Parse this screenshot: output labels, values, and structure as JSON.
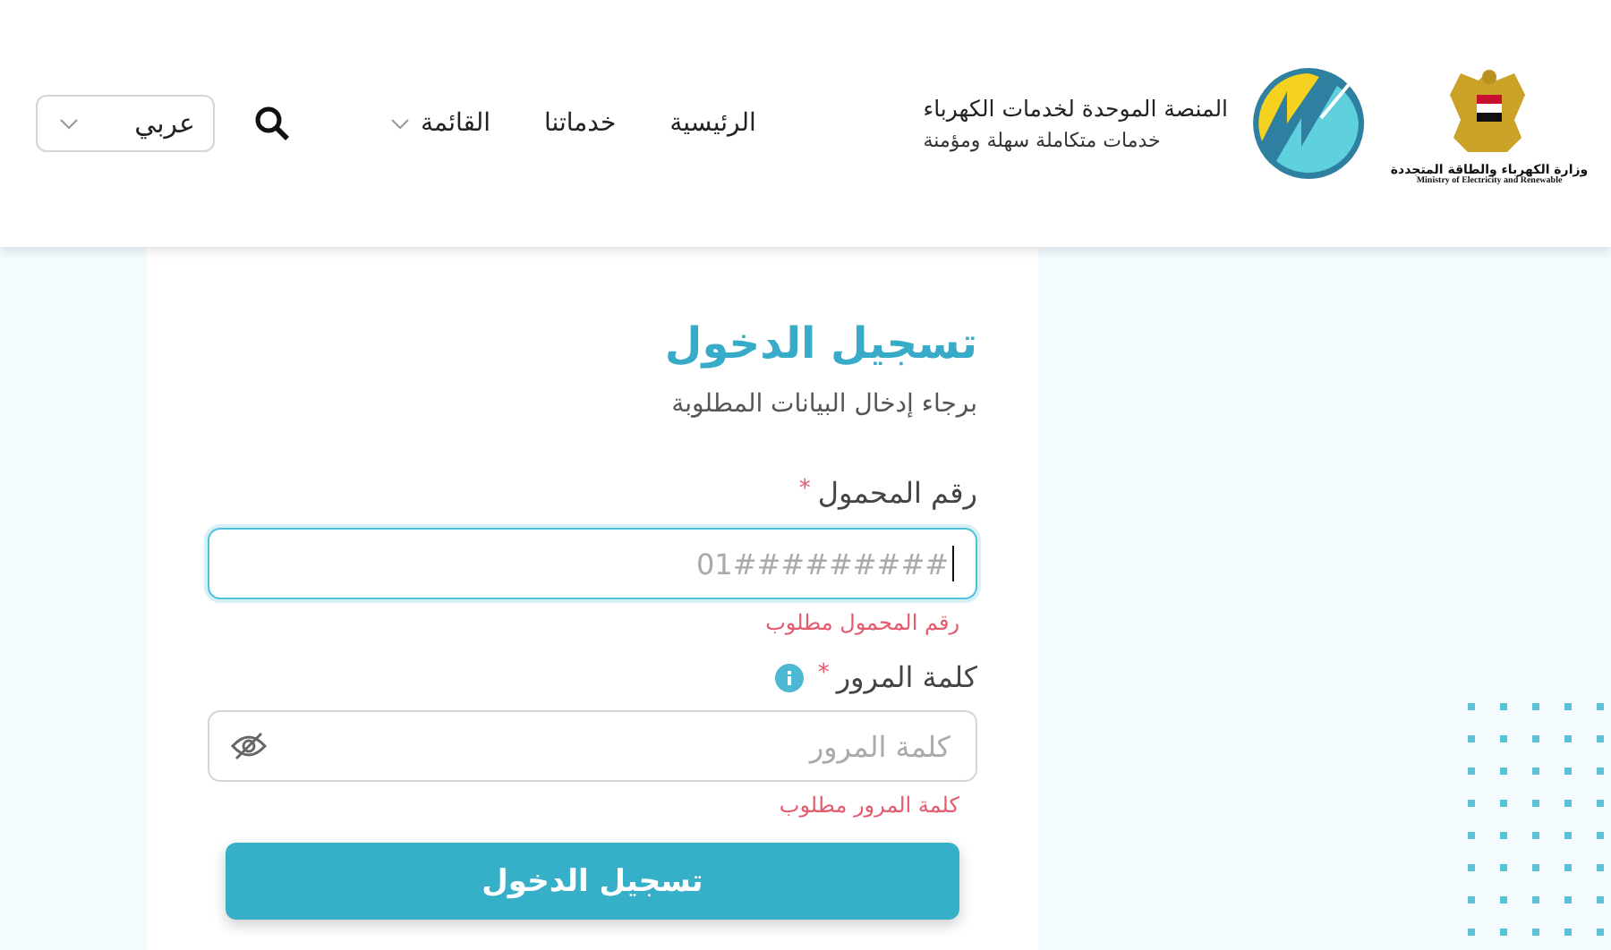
{
  "header": {
    "ministry": {
      "name_ar": "وزارة الكهرباء والطاقة المتجددة",
      "name_en": "Ministry of Electricity and Renewable"
    },
    "platform": {
      "title": "المنصة الموحدة لخدمات الكهرباء",
      "tagline": "خدمات متكاملة سهلة ومؤمنة"
    },
    "nav": [
      {
        "label": "الرئيسية",
        "kind": "link"
      },
      {
        "label": "خدماتنا",
        "kind": "link"
      },
      {
        "label": "القائمة",
        "kind": "dropdown"
      }
    ],
    "language": {
      "value": "عربي"
    }
  },
  "login": {
    "title": "تسجيل الدخول",
    "subtitle": "برجاء إدخال البيانات المطلوبة",
    "fields": [
      {
        "label": "رقم المحمول",
        "required_mark": "*",
        "kind": "text",
        "placeholder": "01#########",
        "focused": true,
        "error": "رقم المحمول مطلوب",
        "info": false
      },
      {
        "label": "كلمة المرور",
        "required_mark": "*",
        "kind": "password",
        "placeholder": "كلمة المرور",
        "focused": false,
        "error": "كلمة المرور مطلوب",
        "info": true
      }
    ],
    "submit": "تسجيل الدخول"
  }
}
